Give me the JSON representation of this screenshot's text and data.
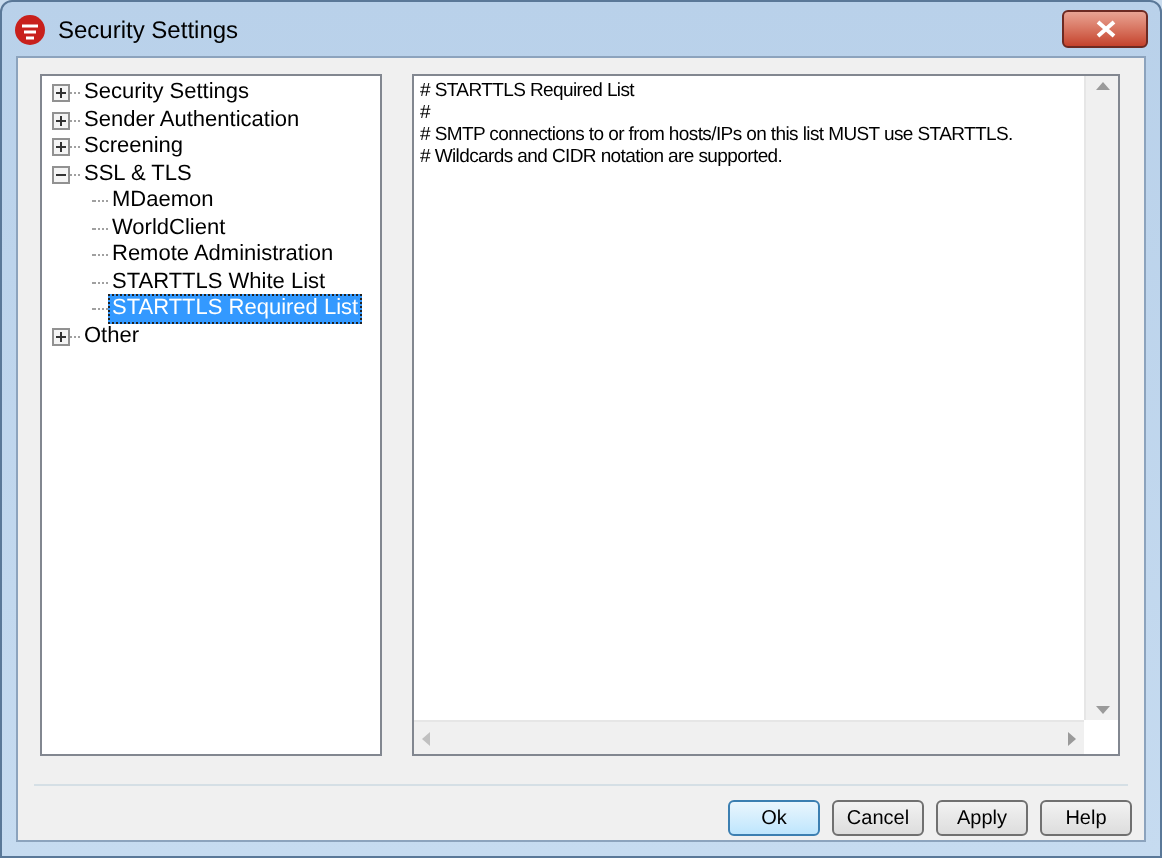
{
  "window": {
    "title": "Security Settings"
  },
  "tree": [
    {
      "label": "Security Settings",
      "expanded": false,
      "selected": false
    },
    {
      "label": "Sender Authentication",
      "expanded": false,
      "selected": false
    },
    {
      "label": "Screening",
      "expanded": false,
      "selected": false
    },
    {
      "label": "SSL & TLS",
      "expanded": true,
      "selected": false,
      "children": [
        {
          "label": "MDaemon",
          "selected": false
        },
        {
          "label": "WorldClient",
          "selected": false
        },
        {
          "label": "Remote Administration",
          "selected": false
        },
        {
          "label": "STARTTLS White List",
          "selected": false
        },
        {
          "label": "STARTTLS Required List",
          "selected": true
        }
      ]
    },
    {
      "label": "Other",
      "expanded": false,
      "selected": false
    }
  ],
  "editor": {
    "lines": [
      "# STARTTLS Required List",
      "#",
      "# SMTP connections to or from hosts/IPs on this list MUST use STARTTLS.",
      "# Wildcards and CIDR notation are supported."
    ]
  },
  "buttons": [
    {
      "label": "Ok",
      "default": true
    },
    {
      "label": "Cancel",
      "default": false
    },
    {
      "label": "Apply",
      "default": false
    },
    {
      "label": "Help",
      "default": false
    }
  ]
}
